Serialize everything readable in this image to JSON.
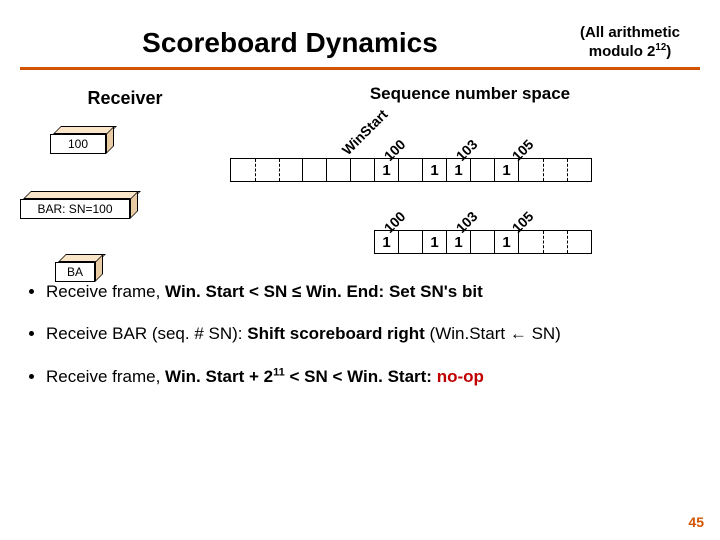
{
  "title": "Scoreboard Dynamics",
  "note_line1": "(All arithmetic",
  "note_line2": "modulo 2",
  "note_exp": "12",
  "note_line2_end": ")",
  "receiver": "Receiver",
  "seq_label": "Sequence number space",
  "box1": "100",
  "box2": "BAR: SN=100",
  "box3": "BA",
  "board1": {
    "labels": {
      "winstart": "WinStart",
      "a": "100",
      "b": "103",
      "c": "105"
    },
    "cells": [
      "",
      "",
      "",
      "",
      "",
      "",
      "1",
      "",
      "1",
      "1",
      "",
      "1",
      "",
      "",
      ""
    ]
  },
  "board2": {
    "labels": {
      "a": "100",
      "b": "103",
      "c": "105"
    },
    "cells": [
      "1",
      "",
      "1",
      "1",
      "",
      "1",
      "",
      "",
      ""
    ]
  },
  "bullets": {
    "b1_pre": "Receive frame, ",
    "b1_mid": "Win. Start < SN ≤ Win. End:",
    "b1_post": " Set SN's bit",
    "b2_pre": "Receive BAR (seq. # SN): ",
    "b2_mid": "Shift scoreboard right",
    "b2_post_a": " (Win.Start ",
    "b2_arrow": "←",
    "b2_post_b": " SN)",
    "b3_pre": "Receive frame, ",
    "b3_mid": "Win. Start + 2",
    "b3_exp": "11",
    "b3_mid2": " < SN < Win. Start:",
    "b3_post": " no-op"
  },
  "slidenum": "45"
}
